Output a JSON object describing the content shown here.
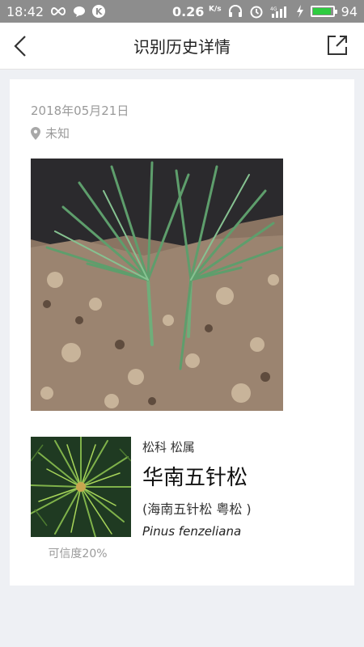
{
  "status_bar": {
    "time": "18:42",
    "net_speed": "0.26",
    "net_unit": "K/s",
    "battery": "94",
    "battery_level": 0.94,
    "k_badge": "K",
    "icons": [
      "infinity-icon",
      "chat-bubble-icon",
      "k-badge-icon",
      "headset-icon",
      "alarm-icon",
      "signal-4g-icon",
      "charging-icon",
      "battery-icon"
    ]
  },
  "nav": {
    "title": "识别历史详情",
    "back_icon": "chevron-left-icon",
    "share_icon": "share-external-icon"
  },
  "record": {
    "date": "2018年05月21日",
    "location": "未知",
    "location_icon": "map-pin-icon"
  },
  "result": {
    "family_genus": "松科 松属",
    "chinese_name": "华南五针松",
    "aliases": "(海南五针松 粤松 )",
    "latin_name": "Pinus fenzeliana",
    "confidence": "可信度20%"
  },
  "colors": {
    "status_bar_bg": "#8d8d8d",
    "page_bg": "#eef0f4",
    "card_bg": "#ffffff",
    "muted_text": "#9a9a9a",
    "battery_green": "#2ecc40"
  }
}
